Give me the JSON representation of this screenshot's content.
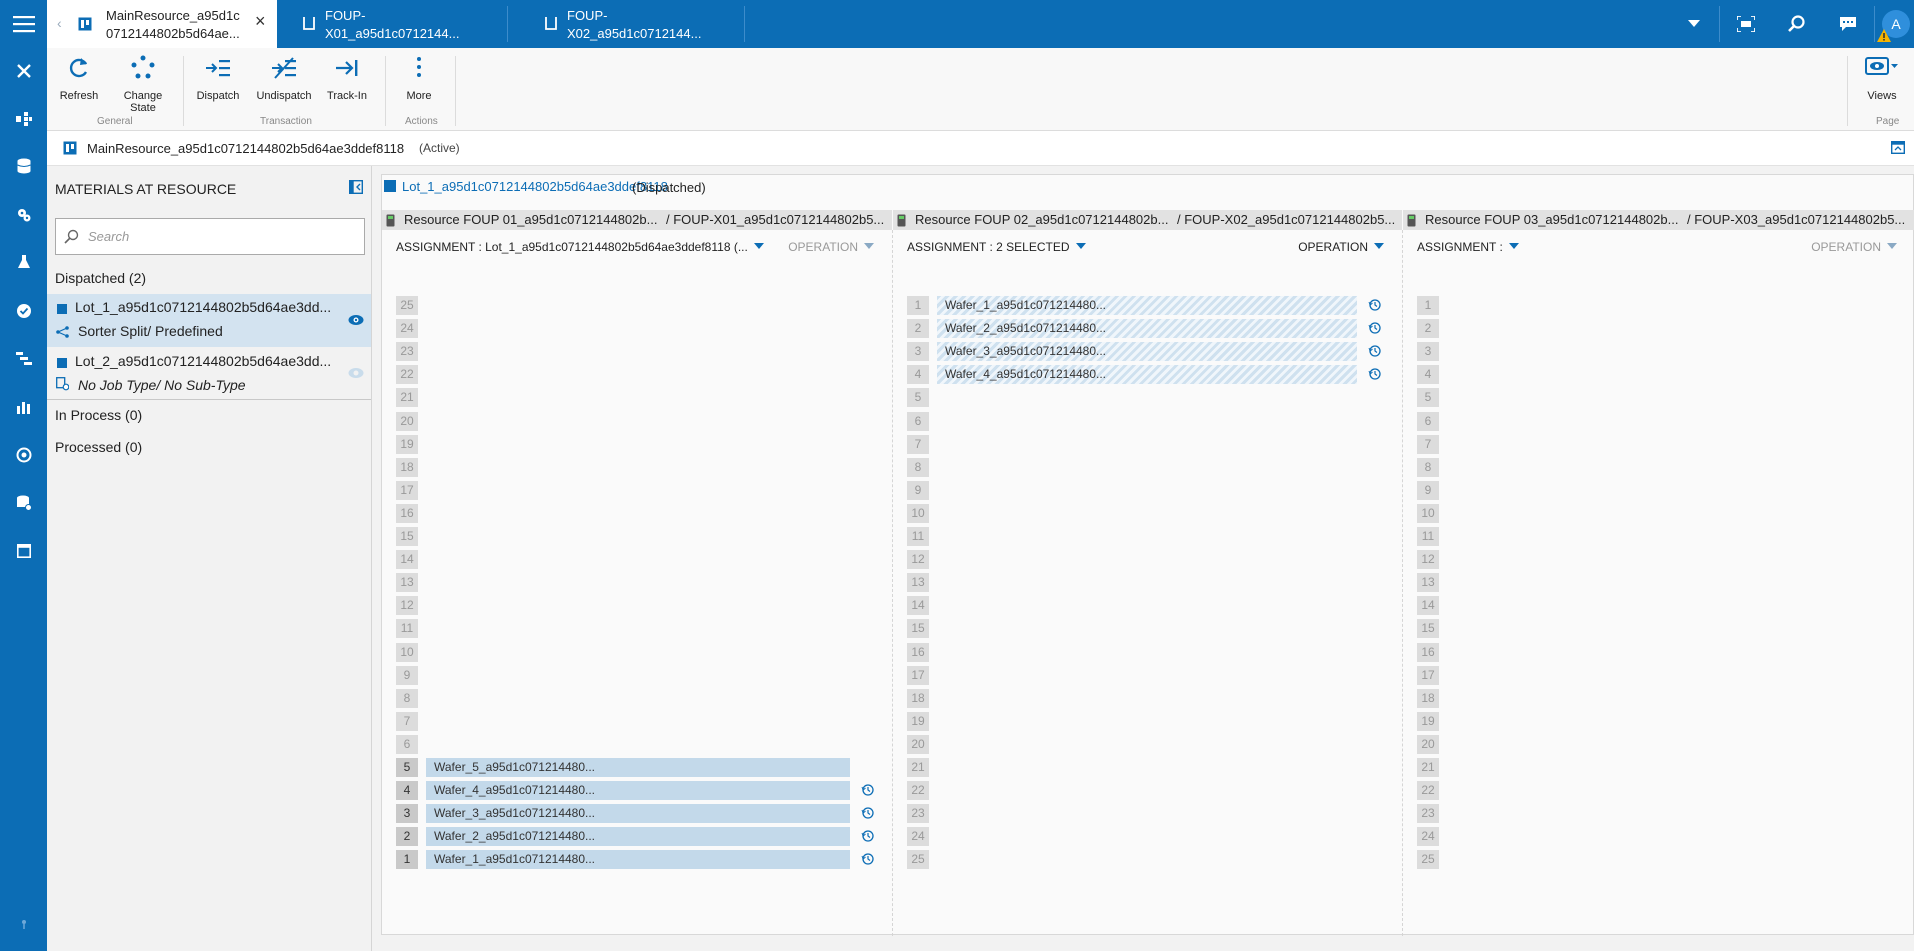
{
  "tabs": [
    {
      "line1": "MainResource_a95d1c",
      "line2": "0712144802b5d64ae..."
    },
    {
      "line1": "FOUP-",
      "line2": "X01_a95d1c0712144..."
    },
    {
      "line1": "FOUP-",
      "line2": "X02_a95d1c0712144..."
    }
  ],
  "user": {
    "avatar_letter": "A"
  },
  "ribbon": {
    "groups": {
      "general": "General",
      "transaction": "Transaction",
      "actions": "Actions",
      "page": "Page"
    },
    "buttons": {
      "refresh": "Refresh",
      "change_state_1": "Change",
      "change_state_2": "State",
      "dispatch": "Dispatch",
      "undispatch": "Undispatch",
      "trackin": "Track-In",
      "more": "More",
      "views": "Views"
    }
  },
  "resource": {
    "name": "MainResource_a95d1c0712144802b5d64ae3ddef8118",
    "status": "(Active)"
  },
  "left_panel": {
    "title": "MATERIALS AT RESOURCE",
    "search_placeholder": "Search",
    "dispatched_header": "Dispatched (2)",
    "lots": [
      {
        "name": "Lot_1_a95d1c0712144802b5d64ae3dd...",
        "sub": "Sorter Split/ Predefined"
      },
      {
        "name": "Lot_2_a95d1c0712144802b5d64ae3dd...",
        "sub": "No Job Type/ No Sub-Type"
      }
    ],
    "in_process_header": "In Process (0)",
    "processed_header": "Processed (0)"
  },
  "lot_header": {
    "name": "Lot_1_a95d1c0712144802b5d64ae3ddef8118",
    "status": "(Dispatched)"
  },
  "columns": [
    {
      "header_a": "Resource FOUP 01_a95d1c0712144802b...",
      "header_b": "/ FOUP-X01_a95d1c0712144802b5...",
      "assignment": "ASSIGNMENT : Lot_1_a95d1c0712144802b5d64ae3ddef8118 (...",
      "operation": "OPERATION",
      "slots": [
        "25",
        "24",
        "23",
        "22",
        "21",
        "20",
        "19",
        "18",
        "17",
        "16",
        "15",
        "14",
        "13",
        "12",
        "11",
        "10",
        "9",
        "8",
        "7",
        "6",
        "5",
        "4",
        "3",
        "2",
        "1"
      ],
      "wafers": [
        {
          "slot": "5",
          "name": "Wafer_5_a95d1c071214480..."
        },
        {
          "slot": "4",
          "name": "Wafer_4_a95d1c071214480..."
        },
        {
          "slot": "3",
          "name": "Wafer_3_a95d1c071214480..."
        },
        {
          "slot": "2",
          "name": "Wafer_2_a95d1c071214480..."
        },
        {
          "slot": "1",
          "name": "Wafer_1_a95d1c071214480..."
        }
      ]
    },
    {
      "header_a": "Resource FOUP 02_a95d1c0712144802b...",
      "header_b": "/ FOUP-X02_a95d1c0712144802b5...",
      "assignment": "ASSIGNMENT : 2 SELECTED",
      "operation": "OPERATION",
      "slots": [
        "1",
        "2",
        "3",
        "4",
        "5",
        "6",
        "7",
        "8",
        "9",
        "10",
        "11",
        "12",
        "13",
        "14",
        "15",
        "16",
        "17",
        "18",
        "19",
        "20",
        "21",
        "22",
        "23",
        "24",
        "25"
      ],
      "wafers": [
        {
          "slot": "1",
          "name": "Wafer_1_a95d1c071214480..."
        },
        {
          "slot": "2",
          "name": "Wafer_2_a95d1c071214480..."
        },
        {
          "slot": "3",
          "name": "Wafer_3_a95d1c071214480..."
        },
        {
          "slot": "4",
          "name": "Wafer_4_a95d1c071214480..."
        }
      ]
    },
    {
      "header_a": "Resource FOUP 03_a95d1c0712144802b...",
      "header_b": "/ FOUP-X03_a95d1c0712144802b5...",
      "assignment": "ASSIGNMENT :",
      "operation": "OPERATION",
      "slots": [
        "1",
        "2",
        "3",
        "4",
        "5",
        "6",
        "7",
        "8",
        "9",
        "10",
        "11",
        "12",
        "13",
        "14",
        "15",
        "16",
        "17",
        "18",
        "19",
        "20",
        "21",
        "22",
        "23",
        "24",
        "25"
      ],
      "wafers": []
    }
  ],
  "colors": {
    "brand_blue": "#0c6db5",
    "wafer_fill": "#c3d9ea",
    "panel_bg": "#f2f2f2"
  }
}
